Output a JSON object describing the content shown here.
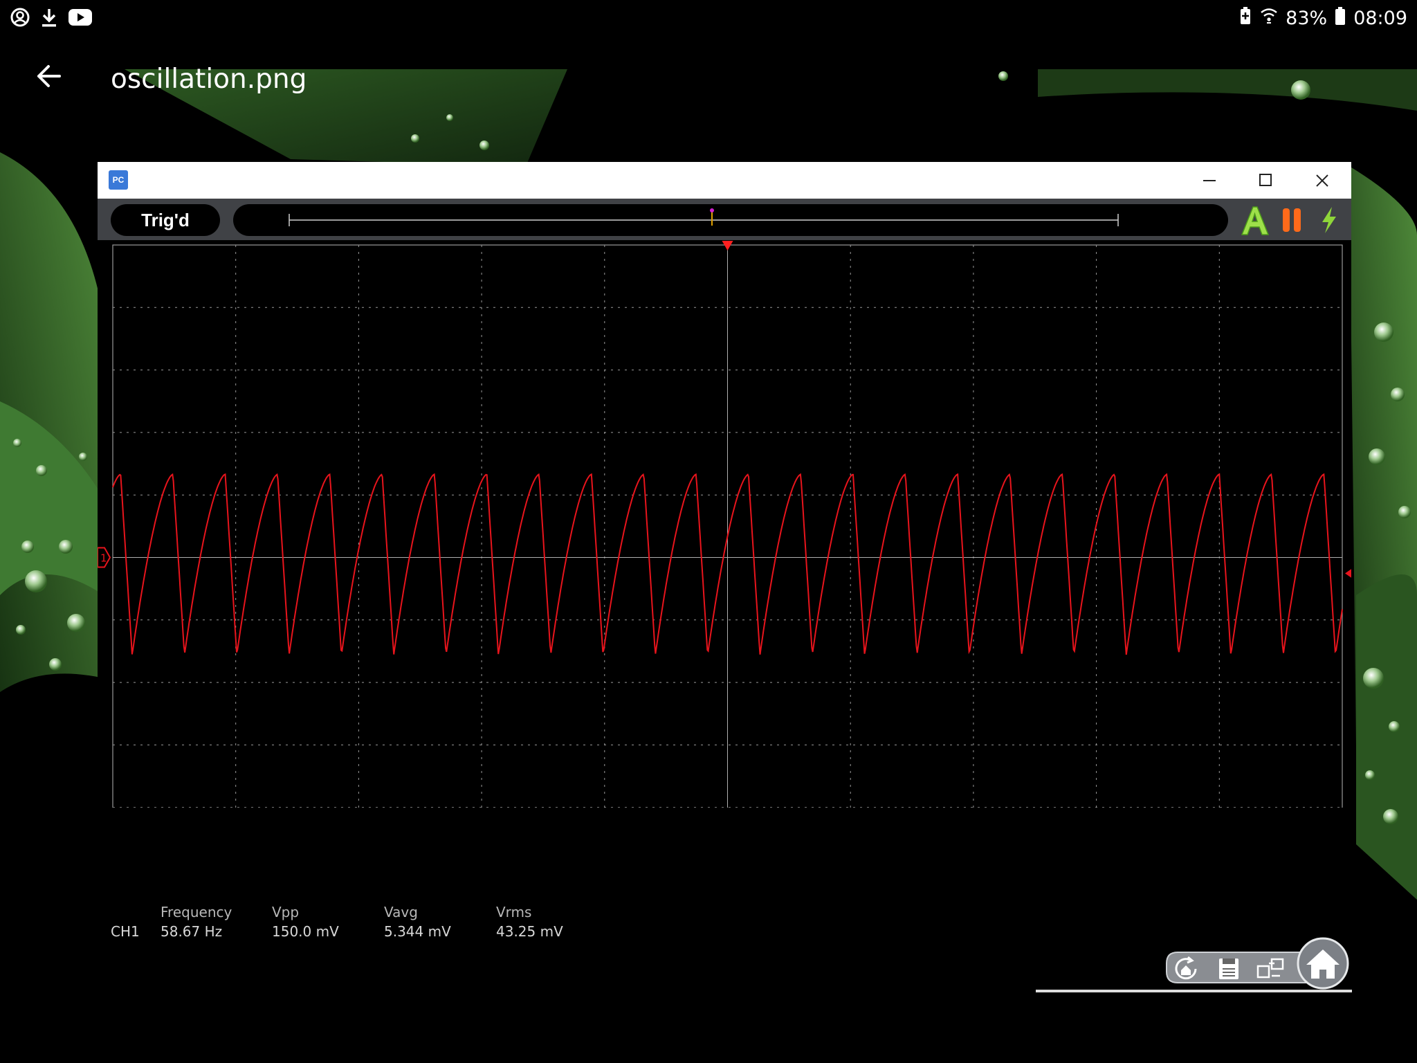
{
  "status_bar": {
    "left_icons": [
      "account-circle-icon",
      "download-icon",
      "youtube-icon"
    ],
    "right_icons": [
      "battery-saver-icon",
      "wifi-icon",
      "battery-icon"
    ],
    "battery": "83%",
    "time": "08:09"
  },
  "viewer": {
    "back_icon": "arrow-back-icon",
    "file_name": "oscillation.png"
  },
  "window": {
    "app_icon_text": "PC",
    "controls": [
      "minimize-icon",
      "maximize-icon",
      "close-icon"
    ],
    "toolbar": {
      "trigger_status": "Trig'd",
      "icons": [
        "auto-setup-icon",
        "pause-icon",
        "lightning-icon"
      ]
    },
    "channel_marker": "1",
    "colors": {
      "trace": "#e8141c",
      "grid": "#9a9a9a",
      "toolbar": "#404246",
      "trigger_marker": "#ff2020"
    }
  },
  "chart_data": {
    "type": "line",
    "title": "",
    "xlabel": "",
    "ylabel": "",
    "grid": true,
    "divisions": {
      "horizontal": 10,
      "vertical": 10
    },
    "trace_unit": "mV",
    "frequency_hz": 58.67,
    "vpp_mv": 150.0,
    "vavg_mv": 5.344,
    "vrms_mv": 43.25,
    "cycles_visible": 23.5,
    "waveform": "sawtooth-like (sharp rise, fall to minimum)",
    "series": [
      {
        "channel": "CH1",
        "color": "#e8141c"
      }
    ]
  },
  "measurements": {
    "channel": "CH1",
    "columns": [
      {
        "label": "Frequency",
        "value": "58.67 Hz"
      },
      {
        "label": "Vpp",
        "value": "150.0 mV"
      },
      {
        "label": "Vavg",
        "value": "5.344 mV"
      },
      {
        "label": "Vrms",
        "value": "43.25 mV"
      }
    ]
  },
  "bottom_toolbar": {
    "icons": [
      "refresh-home-icon",
      "save-icon",
      "swap-windows-icon",
      "home-icon"
    ]
  }
}
